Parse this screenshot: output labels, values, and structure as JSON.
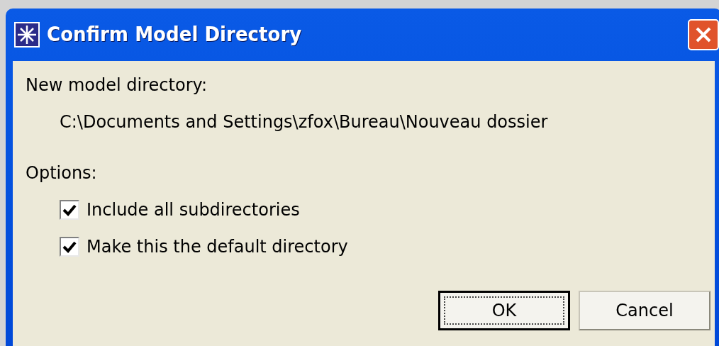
{
  "window": {
    "title": "Confirm Model Directory"
  },
  "directory": {
    "label": "New model directory:",
    "path": "C:\\Documents and Settings\\zfox\\Bureau\\Nouveau dossier"
  },
  "options": {
    "label": "Options:",
    "items": [
      {
        "label": "Include all subdirectories",
        "checked": true
      },
      {
        "label": "Make this the default directory",
        "checked": true
      }
    ]
  },
  "buttons": [
    {
      "label": "OK",
      "selected": true
    },
    {
      "label": "Cancel",
      "selected": false
    }
  ]
}
